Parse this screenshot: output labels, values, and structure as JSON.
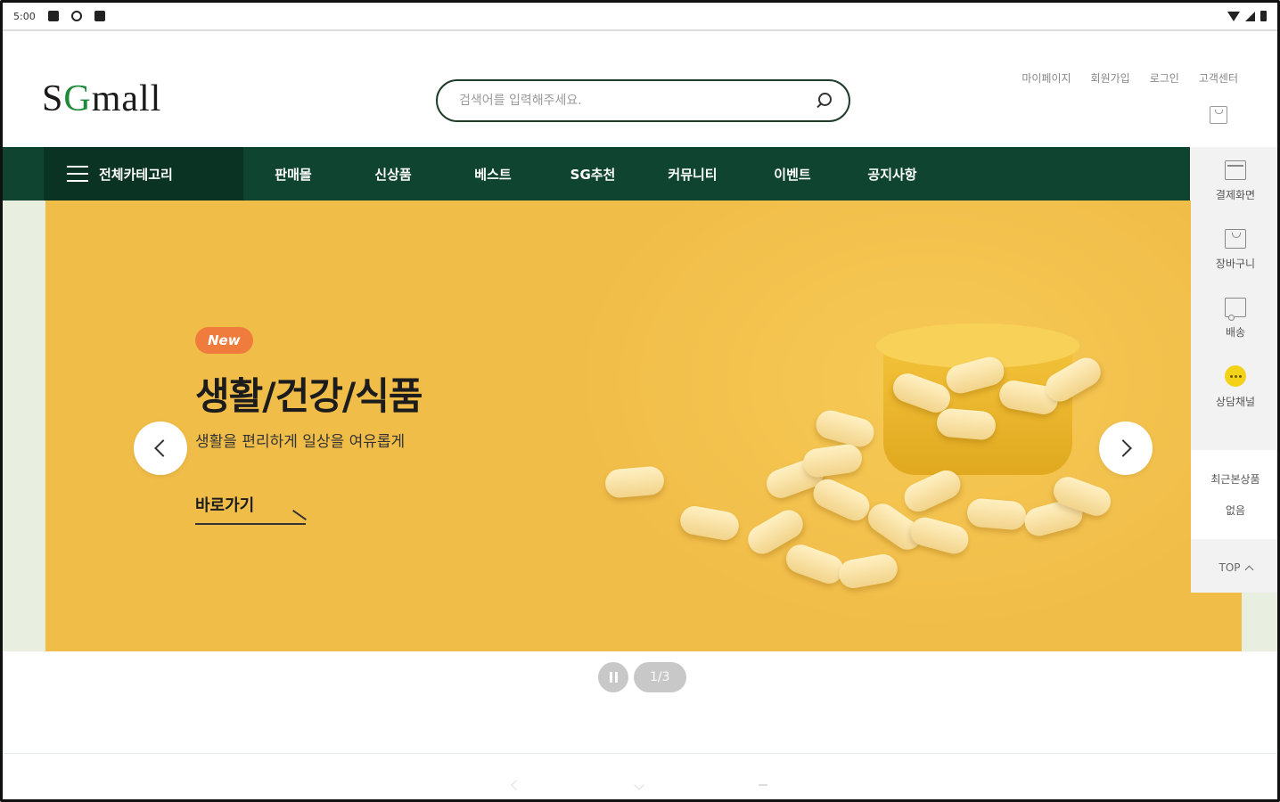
{
  "status_bar": {
    "time": "5:00"
  },
  "header": {
    "logo_s": "S",
    "logo_g": "G",
    "logo_rest": "mall",
    "search_placeholder": "검색어를 입력해주세요.",
    "top_links": [
      "마이페이지",
      "회원가입",
      "로그인",
      "고객센터"
    ]
  },
  "nav": {
    "all_category": "전체카테고리",
    "menu": [
      "판매몰",
      "신상품",
      "베스트",
      "SG추천",
      "커뮤니티",
      "이벤트",
      "공지사항"
    ]
  },
  "hero": {
    "badge": "New",
    "title": "생활/건강/식품",
    "subtitle": "생활을 편리하게 일상을 여유롭게",
    "link": "바로가기"
  },
  "pager": {
    "count": "1/3"
  },
  "side_panel": {
    "items": [
      "결제화면",
      "장바구니",
      "배송",
      "상담채널"
    ],
    "recent_title": "최근본상품",
    "recent_empty": "없음",
    "top": "TOP"
  },
  "colors": {
    "nav_bg": "#0f4430",
    "hero_bg": "#f1bd49",
    "badge": "#ef7c3c",
    "logo_accent": "#1e8a3a"
  }
}
